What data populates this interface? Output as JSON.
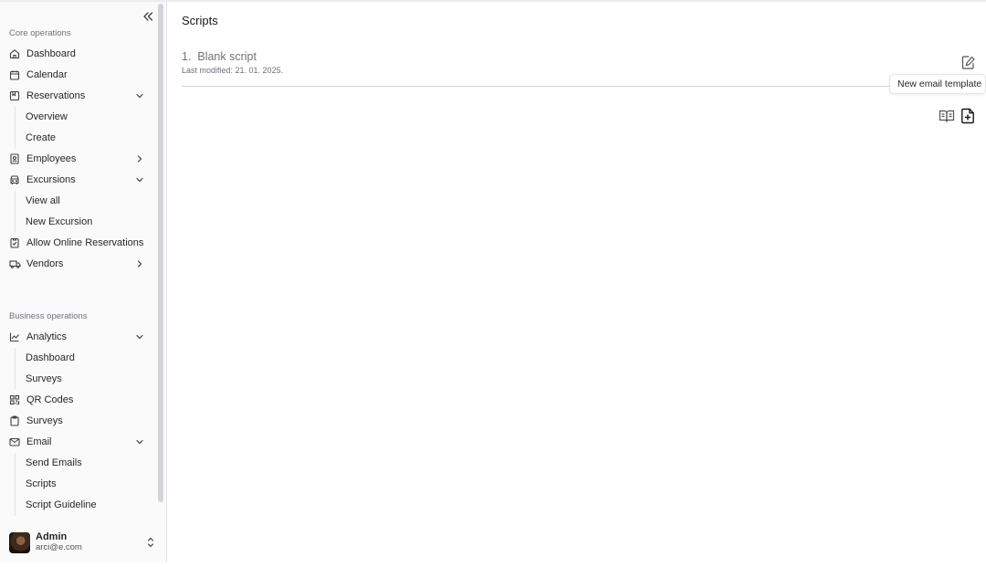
{
  "sidebar": {
    "sections": [
      {
        "label": "Core operations"
      },
      {
        "label": "Business operations"
      }
    ],
    "items": {
      "dashboard": "Dashboard",
      "calendar": "Calendar",
      "reservations": "Reservations",
      "reservations_overview": "Overview",
      "reservations_create": "Create",
      "employees": "Employees",
      "excursions": "Excursions",
      "excursions_view_all": "View all",
      "excursions_new": "New Excursion",
      "allow_online": "Allow Online Reservations",
      "vendors": "Vendors",
      "analytics": "Analytics",
      "analytics_dashboard": "Dashboard",
      "analytics_surveys": "Surveys",
      "qr_codes": "QR Codes",
      "surveys": "Surveys",
      "email": "Email",
      "email_send": "Send Emails",
      "email_scripts": "Scripts",
      "email_guideline": "Script Guideline"
    },
    "user": {
      "name": "Admin",
      "email": "arci@e.com"
    }
  },
  "main": {
    "title": "Scripts",
    "scripts": [
      {
        "title": "1.  Blank script",
        "meta": "Last modified: 21. 01. 2025."
      }
    ],
    "tooltip": "New email template"
  },
  "icons": [
    "collapse-icon",
    "home-icon",
    "calendar-icon",
    "reservations-icon",
    "employees-icon",
    "excursions-icon",
    "allow-online-icon",
    "vendors-icon",
    "analytics-icon",
    "qr-code-icon",
    "clipboard-icon",
    "mail-icon",
    "edit-icon",
    "book-icon",
    "new-file-icon"
  ]
}
